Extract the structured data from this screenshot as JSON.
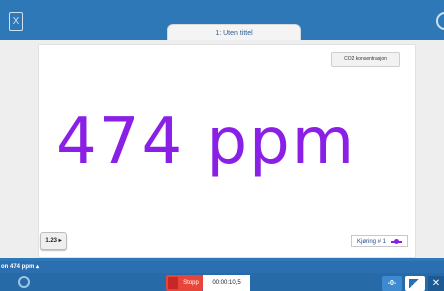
{
  "header": {
    "doc_icon": "document-icon",
    "settings_icon": "gear-icon",
    "tab_label": "1: Uten tittel"
  },
  "display": {
    "sensor_label": "CO2 konsentrasjon",
    "value": "474 ppm",
    "value_color": "#8a1fe6",
    "decimals_button": "1.23 ▸",
    "run_legend": "Kjøring # 1"
  },
  "status": {
    "readout_label": "on 474 ppm ▴"
  },
  "footer": {
    "power_icon": "power-icon",
    "stop_label": "Stopp",
    "timer": "00:00:10,5",
    "zero_label": "-0-",
    "export_icon": "map-export-icon",
    "close_icon": "close-icon"
  },
  "colors": {
    "accent": "#2f78b8",
    "stop": "#e8453a",
    "reading": "#8a1fe6"
  }
}
